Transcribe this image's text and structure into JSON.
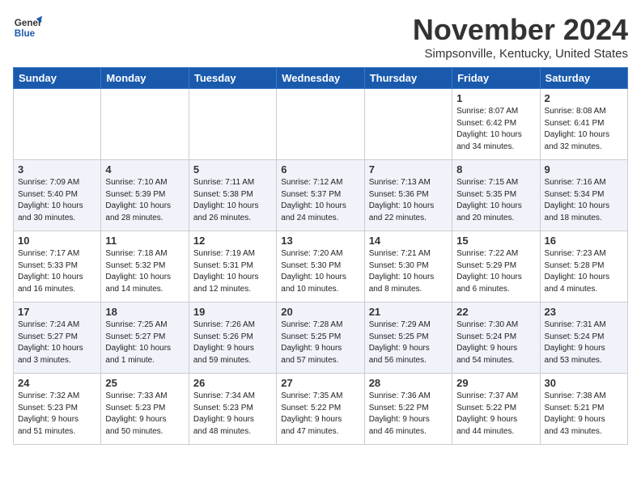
{
  "header": {
    "logo_line1": "General",
    "logo_line2": "Blue",
    "month": "November 2024",
    "location": "Simpsonville, Kentucky, United States"
  },
  "weekdays": [
    "Sunday",
    "Monday",
    "Tuesday",
    "Wednesday",
    "Thursday",
    "Friday",
    "Saturday"
  ],
  "weeks": [
    [
      {
        "day": "",
        "info": ""
      },
      {
        "day": "",
        "info": ""
      },
      {
        "day": "",
        "info": ""
      },
      {
        "day": "",
        "info": ""
      },
      {
        "day": "",
        "info": ""
      },
      {
        "day": "1",
        "info": "Sunrise: 8:07 AM\nSunset: 6:42 PM\nDaylight: 10 hours\nand 34 minutes."
      },
      {
        "day": "2",
        "info": "Sunrise: 8:08 AM\nSunset: 6:41 PM\nDaylight: 10 hours\nand 32 minutes."
      }
    ],
    [
      {
        "day": "3",
        "info": "Sunrise: 7:09 AM\nSunset: 5:40 PM\nDaylight: 10 hours\nand 30 minutes."
      },
      {
        "day": "4",
        "info": "Sunrise: 7:10 AM\nSunset: 5:39 PM\nDaylight: 10 hours\nand 28 minutes."
      },
      {
        "day": "5",
        "info": "Sunrise: 7:11 AM\nSunset: 5:38 PM\nDaylight: 10 hours\nand 26 minutes."
      },
      {
        "day": "6",
        "info": "Sunrise: 7:12 AM\nSunset: 5:37 PM\nDaylight: 10 hours\nand 24 minutes."
      },
      {
        "day": "7",
        "info": "Sunrise: 7:13 AM\nSunset: 5:36 PM\nDaylight: 10 hours\nand 22 minutes."
      },
      {
        "day": "8",
        "info": "Sunrise: 7:15 AM\nSunset: 5:35 PM\nDaylight: 10 hours\nand 20 minutes."
      },
      {
        "day": "9",
        "info": "Sunrise: 7:16 AM\nSunset: 5:34 PM\nDaylight: 10 hours\nand 18 minutes."
      }
    ],
    [
      {
        "day": "10",
        "info": "Sunrise: 7:17 AM\nSunset: 5:33 PM\nDaylight: 10 hours\nand 16 minutes."
      },
      {
        "day": "11",
        "info": "Sunrise: 7:18 AM\nSunset: 5:32 PM\nDaylight: 10 hours\nand 14 minutes."
      },
      {
        "day": "12",
        "info": "Sunrise: 7:19 AM\nSunset: 5:31 PM\nDaylight: 10 hours\nand 12 minutes."
      },
      {
        "day": "13",
        "info": "Sunrise: 7:20 AM\nSunset: 5:30 PM\nDaylight: 10 hours\nand 10 minutes."
      },
      {
        "day": "14",
        "info": "Sunrise: 7:21 AM\nSunset: 5:30 PM\nDaylight: 10 hours\nand 8 minutes."
      },
      {
        "day": "15",
        "info": "Sunrise: 7:22 AM\nSunset: 5:29 PM\nDaylight: 10 hours\nand 6 minutes."
      },
      {
        "day": "16",
        "info": "Sunrise: 7:23 AM\nSunset: 5:28 PM\nDaylight: 10 hours\nand 4 minutes."
      }
    ],
    [
      {
        "day": "17",
        "info": "Sunrise: 7:24 AM\nSunset: 5:27 PM\nDaylight: 10 hours\nand 3 minutes."
      },
      {
        "day": "18",
        "info": "Sunrise: 7:25 AM\nSunset: 5:27 PM\nDaylight: 10 hours\nand 1 minute."
      },
      {
        "day": "19",
        "info": "Sunrise: 7:26 AM\nSunset: 5:26 PM\nDaylight: 9 hours\nand 59 minutes."
      },
      {
        "day": "20",
        "info": "Sunrise: 7:28 AM\nSunset: 5:25 PM\nDaylight: 9 hours\nand 57 minutes."
      },
      {
        "day": "21",
        "info": "Sunrise: 7:29 AM\nSunset: 5:25 PM\nDaylight: 9 hours\nand 56 minutes."
      },
      {
        "day": "22",
        "info": "Sunrise: 7:30 AM\nSunset: 5:24 PM\nDaylight: 9 hours\nand 54 minutes."
      },
      {
        "day": "23",
        "info": "Sunrise: 7:31 AM\nSunset: 5:24 PM\nDaylight: 9 hours\nand 53 minutes."
      }
    ],
    [
      {
        "day": "24",
        "info": "Sunrise: 7:32 AM\nSunset: 5:23 PM\nDaylight: 9 hours\nand 51 minutes."
      },
      {
        "day": "25",
        "info": "Sunrise: 7:33 AM\nSunset: 5:23 PM\nDaylight: 9 hours\nand 50 minutes."
      },
      {
        "day": "26",
        "info": "Sunrise: 7:34 AM\nSunset: 5:23 PM\nDaylight: 9 hours\nand 48 minutes."
      },
      {
        "day": "27",
        "info": "Sunrise: 7:35 AM\nSunset: 5:22 PM\nDaylight: 9 hours\nand 47 minutes."
      },
      {
        "day": "28",
        "info": "Sunrise: 7:36 AM\nSunset: 5:22 PM\nDaylight: 9 hours\nand 46 minutes."
      },
      {
        "day": "29",
        "info": "Sunrise: 7:37 AM\nSunset: 5:22 PM\nDaylight: 9 hours\nand 44 minutes."
      },
      {
        "day": "30",
        "info": "Sunrise: 7:38 AM\nSunset: 5:21 PM\nDaylight: 9 hours\nand 43 minutes."
      }
    ]
  ]
}
